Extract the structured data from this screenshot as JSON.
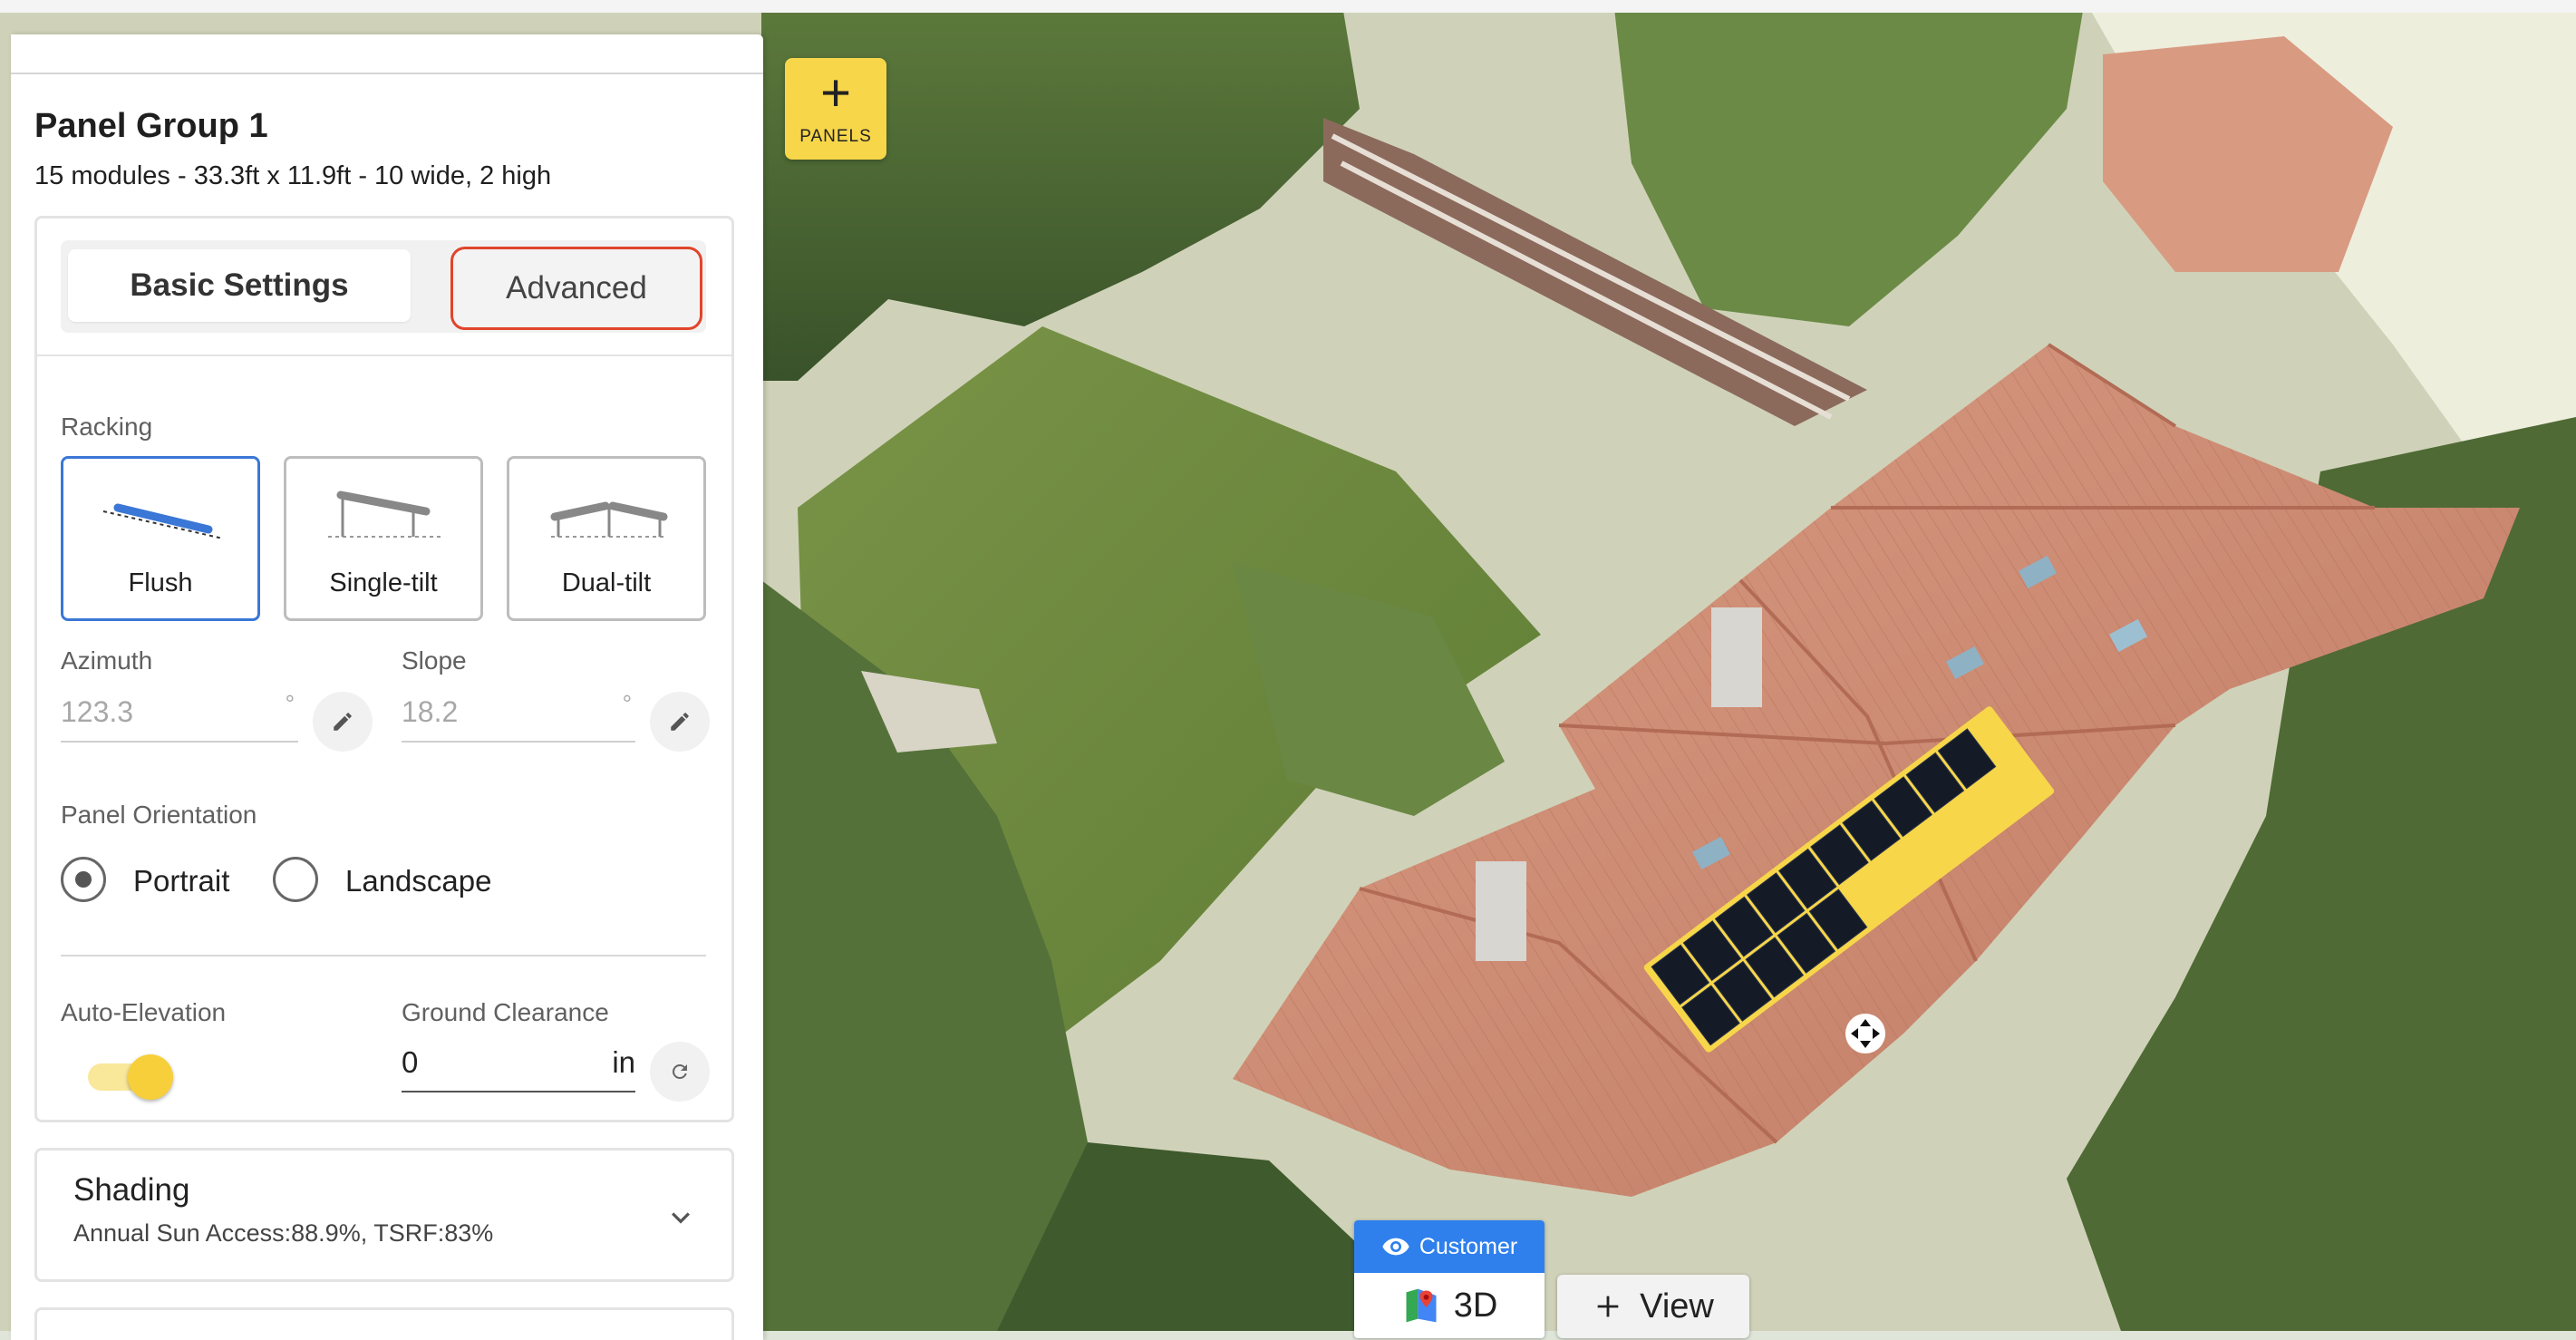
{
  "toolbar": {
    "panels_label": "PANELS",
    "panels_plus": "+"
  },
  "panel_group": {
    "title": "Panel Group 1",
    "summary": "15 modules - 33.3ft x 11.9ft - 10 wide, 2 high"
  },
  "tabs": {
    "basic": "Basic Settings",
    "advanced": "Advanced",
    "active": "Basic Settings"
  },
  "racking": {
    "label": "Racking",
    "options": [
      {
        "label": "Flush",
        "selected": true
      },
      {
        "label": "Single-tilt",
        "selected": false
      },
      {
        "label": "Dual-tilt",
        "selected": false
      }
    ]
  },
  "azimuth": {
    "label": "Azimuth",
    "value": "123.3",
    "unit": "°"
  },
  "slope": {
    "label": "Slope",
    "value": "18.2",
    "unit": "°"
  },
  "orientation": {
    "label": "Panel Orientation",
    "options": [
      "Portrait",
      "Landscape"
    ],
    "selected": "Portrait"
  },
  "auto_elevation": {
    "label": "Auto-Elevation",
    "enabled": true
  },
  "ground_clearance": {
    "label": "Ground Clearance",
    "value": "0",
    "unit": "in"
  },
  "shading": {
    "title": "Shading",
    "summary": "Annual Sun Access:88.9%, TSRF:83%"
  },
  "view_controls": {
    "customer_label": "Customer",
    "view_3d_label": "3D",
    "add_view_label": "View"
  },
  "colors": {
    "accent_yellow": "#f7d64a",
    "selected_blue": "#3a77d6",
    "tab_highlight_red": "#e0452b",
    "customer_blue": "#2f80ed"
  },
  "icons": {
    "panels": "plus-icon",
    "azimuth_edit": "pencil-icon",
    "slope_edit": "pencil-icon",
    "ground_clearance_reset": "refresh-icon",
    "shading_expand": "chevron-down-icon",
    "customer": "eye-icon",
    "view_3d": "google-maps-icon",
    "add_view": "plus-icon",
    "move": "move-arrows-icon"
  }
}
